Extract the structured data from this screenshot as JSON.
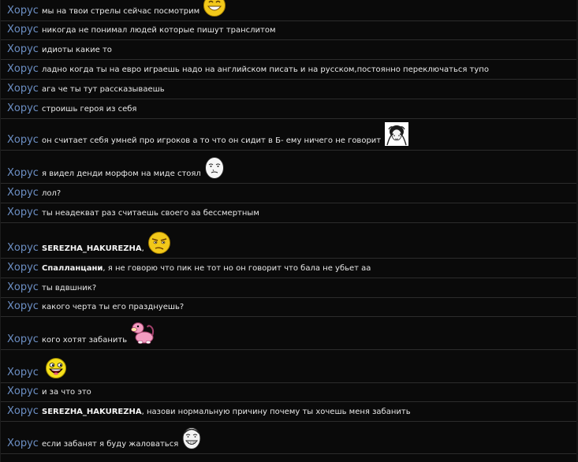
{
  "chat": {
    "messages": [
      {
        "nick": "Хорус",
        "text": "мы на твои стрелы сейчас посмотрим",
        "emote": "laughing-smiley-icon"
      },
      {
        "nick": "Хорус",
        "text": "никогда не понимал людей которые пишут транслитом"
      },
      {
        "nick": "Хорус",
        "text": "идиоты какие то"
      },
      {
        "nick": "Хорус",
        "text": "ладно когда ты на евро играешь надо на английском писать и на русском,постоянно переключаться тупо"
      },
      {
        "nick": "Хорус",
        "text": "ага че ты тут рассказываешь"
      },
      {
        "nick": "Хорус",
        "text": "строишь героя из себя"
      },
      {
        "nick": "Хорус",
        "text": "он считает себя умней про игроков а то что он сидит в Б- ему ничего не говорит",
        "emote": "facepalm-meme-icon"
      },
      {
        "nick": "Хорус",
        "text": "я видел денди морфом на миде стоял",
        "emote": "okay-face-meme-icon"
      },
      {
        "nick": "Хорус",
        "text": "лол?"
      },
      {
        "nick": "Хорус",
        "text": "ты неадекват раз считаешь своего аа бессмертным"
      },
      {
        "nick": "Хорус",
        "addressee": "SEREZHA_HAKUREZHA",
        "text": ",",
        "emote": "suspicious-smiley-icon"
      },
      {
        "nick": "Хорус",
        "addressee": "Спалланцани",
        "text": ", я не говорю что пик не тот но он говорит что бала не убьет аа"
      },
      {
        "nick": "Хорус",
        "text": "ты вдвшник?"
      },
      {
        "nick": "Хорус",
        "text": "какого черта ты его празднуешь?"
      },
      {
        "nick": "Хорус",
        "text": "кого хотят забанить",
        "emote": "slowpoke-icon"
      },
      {
        "nick": "Хорус",
        "text": "",
        "emote": "awesome-face-smiley-icon"
      },
      {
        "nick": "Хорус",
        "text": "и за что это"
      },
      {
        "nick": "Хорус",
        "addressee": "SEREZHA_HAKUREZHA",
        "text": ", назови нормальную причину почему ты хочешь меня забанить"
      },
      {
        "nick": "Хорус",
        "text": "если забанят я буду жаловаться",
        "emote": "yao-ming-meme-icon"
      }
    ]
  }
}
